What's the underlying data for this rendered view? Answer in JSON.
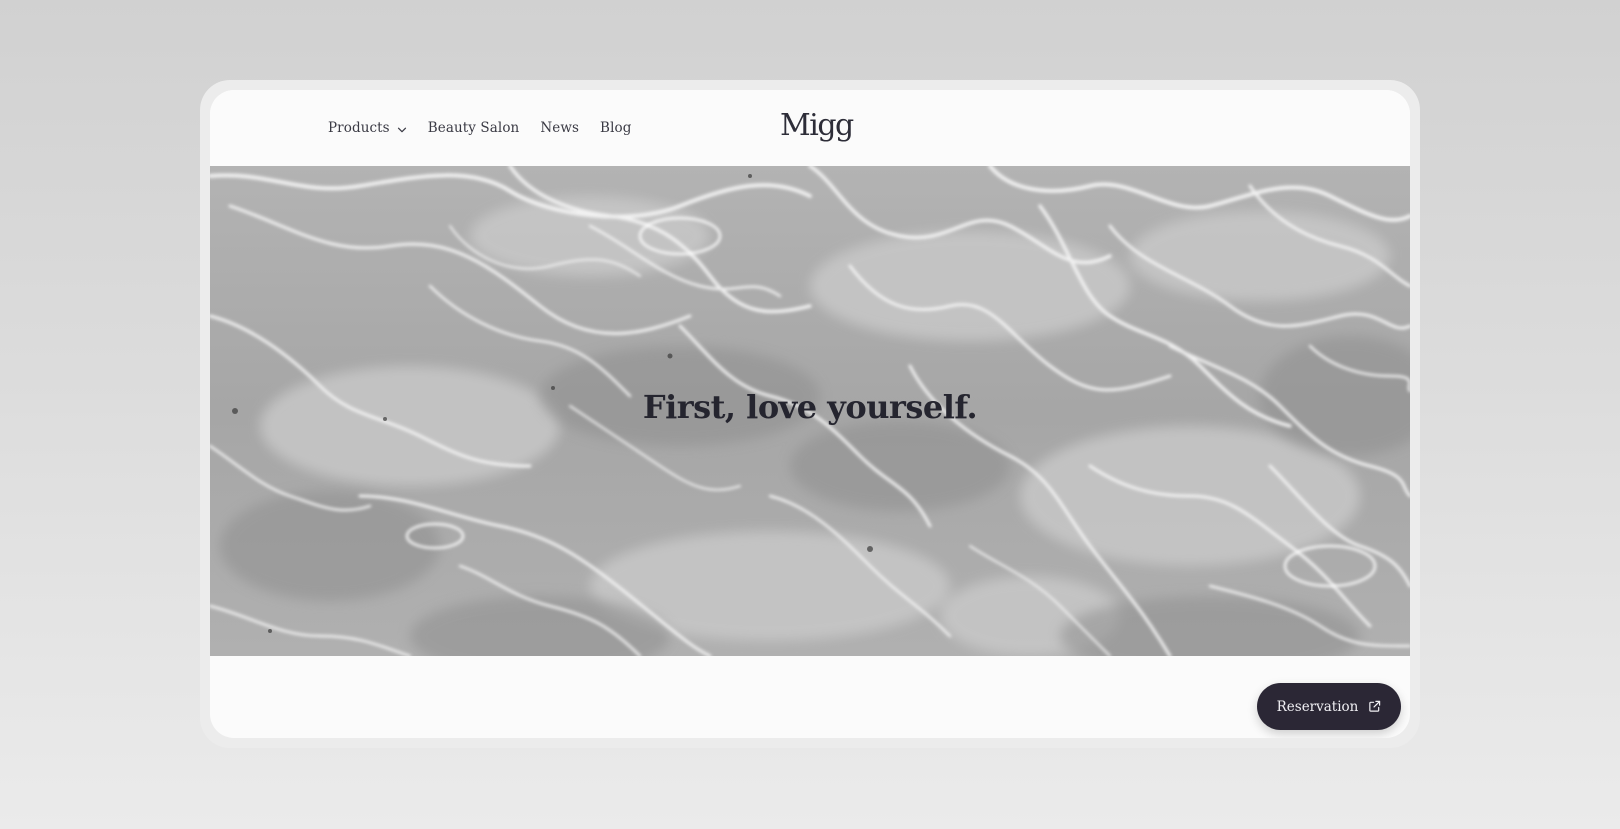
{
  "brand": {
    "logo_text": "Migg"
  },
  "nav": {
    "items": [
      {
        "label": "Products",
        "has_dropdown": true
      },
      {
        "label": "Beauty Salon"
      },
      {
        "label": "News"
      },
      {
        "label": "Blog"
      }
    ]
  },
  "hero": {
    "tagline": "First, love yourself."
  },
  "cta": {
    "label": "Reservation",
    "icon": "external-link-icon"
  },
  "colors": {
    "button_bg": "#2b2735",
    "text_dark": "#25252f",
    "page_bg": "#fbfbfb"
  }
}
